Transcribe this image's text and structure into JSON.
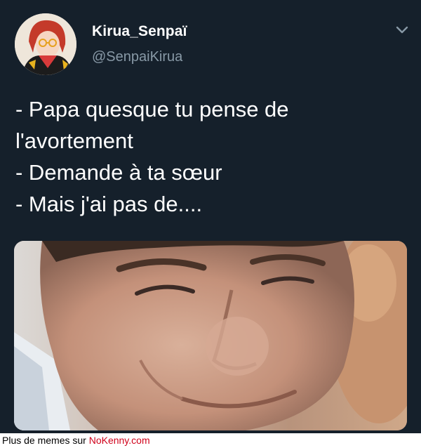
{
  "tweet": {
    "author_name": "Kirua_Senpaï",
    "author_handle": "@SenpaiKirua",
    "avatar_icon": "anime-avatar-icon",
    "menu_icon": "chevron-down-icon",
    "text_lines": [
      "- Papa quesque tu pense de",
      "l'avortement",
      "- Demande à ta sœur",
      "- Mais j'ai pas de...."
    ],
    "media_description": ""
  },
  "footer": {
    "prefix": "Plus de memes sur ",
    "site": "NoKenny.com"
  },
  "colors": {
    "background": "#15202b",
    "text": "#ffffff",
    "secondary_text": "#8899a6",
    "footer_link": "#d0021b"
  }
}
